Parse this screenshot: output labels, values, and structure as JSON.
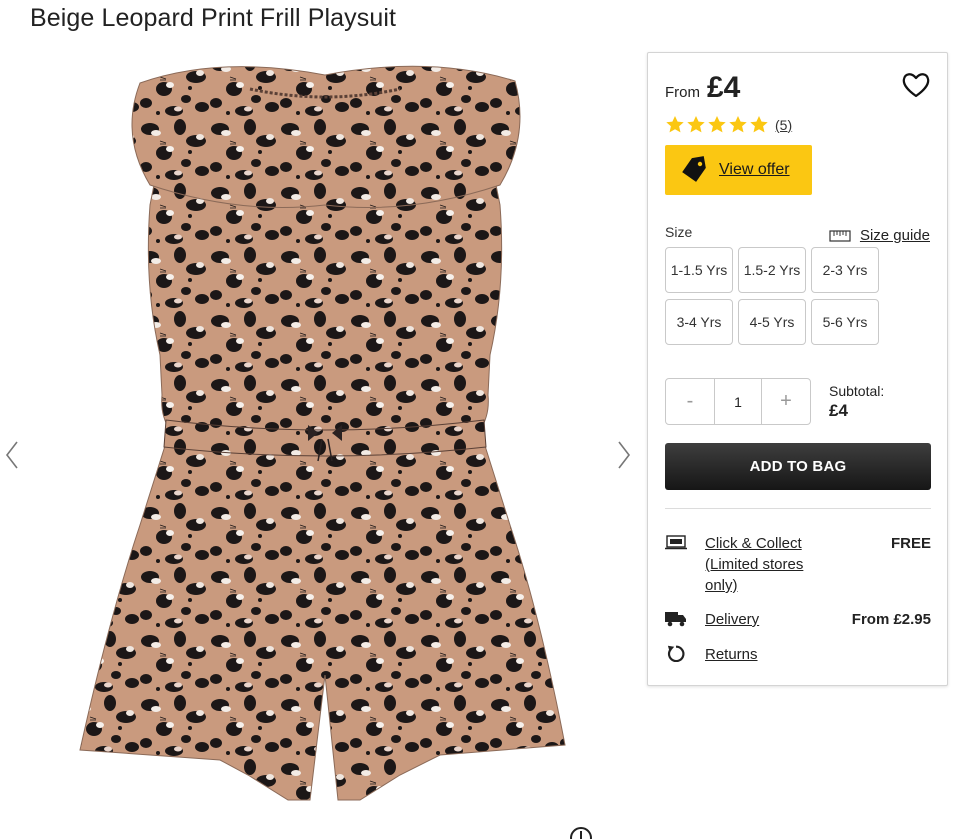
{
  "product": {
    "title": "Beige Leopard Print Frill Playsuit"
  },
  "gallery": {
    "prev_icon": "chevron-left-icon",
    "next_icon": "chevron-right-icon",
    "image_alt": "leopard-print-playsuit-photo",
    "zoom_icon": "zoom-icon"
  },
  "buybox": {
    "price_prefix": "From",
    "price": "£4",
    "rating": {
      "stars": 5,
      "count_label": "(5)"
    },
    "offer_label": "View offer",
    "size_label": "Size",
    "size_guide_label": "Size guide",
    "sizes": [
      "1-1.5 Yrs",
      "1.5-2 Yrs",
      "2-3 Yrs",
      "3-4 Yrs",
      "4-5 Yrs",
      "5-6 Yrs"
    ],
    "quantity": {
      "minus": "-",
      "value": "1",
      "plus": "+"
    },
    "subtotal_label": "Subtotal:",
    "subtotal_value": "£4",
    "add_to_bag_label": "ADD TO BAG",
    "delivery_options": [
      {
        "label": "Click & Collect (Limited stores only)",
        "price": "FREE",
        "icon": "click-collect-icon"
      },
      {
        "label": "Delivery",
        "price": "From £2.95",
        "icon": "truck-icon"
      },
      {
        "label": "Returns",
        "price": "",
        "icon": "returns-icon"
      }
    ]
  },
  "colors": {
    "accent_yellow": "#fbc712",
    "button_dark": "#1e1e1e",
    "fabric_beige": "#c99a7e",
    "print_dark": "#1c1717"
  }
}
